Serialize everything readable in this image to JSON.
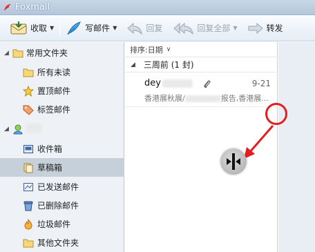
{
  "app": {
    "title": "Foxmail"
  },
  "toolbar": {
    "receive_label": "收取",
    "compose_label": "写邮件",
    "reply_label": "回复",
    "reply_all_label": "回复全部",
    "forward_label": "转发"
  },
  "sidebar": {
    "items": [
      {
        "label": "常用文件夹",
        "icon": "folder-icon",
        "expanded": true
      },
      {
        "label": "所有未读",
        "icon": "folder-icon"
      },
      {
        "label": "置顶邮件",
        "icon": "star-icon"
      },
      {
        "label": "标签邮件",
        "icon": "tag-icon"
      },
      {
        "label": "",
        "icon": "account-avatar-icon",
        "expanded": true
      },
      {
        "label": "收件箱",
        "icon": "inbox-icon"
      },
      {
        "label": "草稿箱",
        "icon": "drafts-icon",
        "selected": true
      },
      {
        "label": "已发送邮件",
        "icon": "sent-icon"
      },
      {
        "label": "已删除邮件",
        "icon": "trash-icon"
      },
      {
        "label": "垃圾邮件",
        "icon": "junk-icon"
      },
      {
        "label": "其他文件夹",
        "icon": "folder-icon"
      }
    ]
  },
  "message_list": {
    "sort_label": "排序:日期",
    "group_label": "三周前 (1 封)",
    "messages": [
      {
        "from": "dey",
        "date": "9-21",
        "snippet_start": "香港展秋展/",
        "snippet_end": "报告,香港展...",
        "has_attachment": true
      }
    ]
  },
  "colors": {
    "accent_red": "#e41d1d",
    "selected_row": "#c6d0da",
    "sidebar_bg": "#eef2f7",
    "toolbar_bg": "#e4ecf5"
  }
}
